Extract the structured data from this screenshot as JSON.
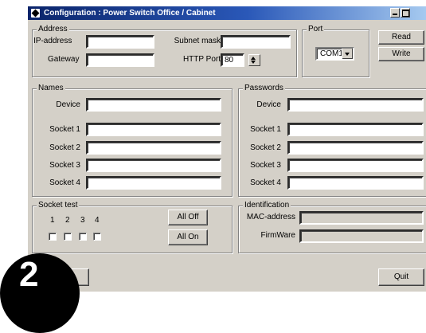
{
  "window": {
    "title": "Configuration : Power Switch Office / Cabinet"
  },
  "address": {
    "legend": "Address",
    "ip_label": "IP-address",
    "ip_value": "",
    "subnet_label": "Subnet mask",
    "subnet_value": "",
    "gateway_label": "Gateway",
    "gateway_value": "",
    "http_port_label": "HTTP Port",
    "http_port_value": "80"
  },
  "port": {
    "legend": "Port",
    "selected": "COM1"
  },
  "actions": {
    "read_label": "Read",
    "write_label": "Write"
  },
  "names": {
    "legend": "Names",
    "device_label": "Device",
    "sockets": [
      "Socket 1",
      "Socket 2",
      "Socket 3",
      "Socket 4"
    ]
  },
  "passwords": {
    "legend": "Passwords",
    "device_label": "Device",
    "sockets": [
      "Socket 1",
      "Socket 2",
      "Socket 3",
      "Socket 4"
    ]
  },
  "socket_test": {
    "legend": "Socket test",
    "numbers": [
      "1",
      "2",
      "3",
      "4"
    ],
    "all_off_label": "All Off",
    "all_on_label": "All On"
  },
  "identification": {
    "legend": "Identification",
    "mac_label": "MAC-address",
    "mac_value": "",
    "firmware_label": "FirmWare",
    "firmware_value": ""
  },
  "footer": {
    "quit_label": "Quit"
  },
  "badge": {
    "number": "2"
  },
  "icons": [
    "app-icon",
    "minimize-icon",
    "maximize-icon",
    "dropdown-arrow-icon",
    "spin-icon"
  ],
  "colors": {
    "title_gradient_start": "#0a246a",
    "title_gradient_end": "#a6caf0",
    "window_face": "#d4d0c8"
  }
}
